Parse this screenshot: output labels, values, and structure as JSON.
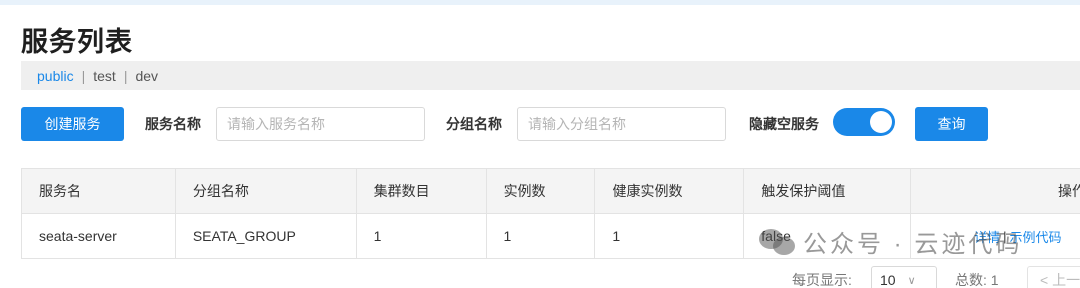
{
  "header": {
    "title": "服务列表"
  },
  "namespaces": {
    "items": [
      {
        "label": "public",
        "active": true
      },
      {
        "label": "test",
        "active": false
      },
      {
        "label": "dev",
        "active": false
      }
    ],
    "separator": "|"
  },
  "toolbar": {
    "create_label": "创建服务",
    "service_name_label": "服务名称",
    "service_name_placeholder": "请输入服务名称",
    "group_name_label": "分组名称",
    "group_name_placeholder": "请输入分组名称",
    "hide_empty_label": "隐藏空服务",
    "hide_empty_on": true,
    "query_label": "查询"
  },
  "table": {
    "columns": [
      "服务名",
      "分组名称",
      "集群数目",
      "实例数",
      "健康实例数",
      "触发保护阈值",
      "操作"
    ],
    "rows": [
      {
        "service": "seata-server",
        "group": "SEATA_GROUP",
        "clusters": "1",
        "instances": "1",
        "healthy": "1",
        "threshold": "false",
        "actions": [
          "详情",
          "示例代码"
        ],
        "action_sep": "|"
      }
    ]
  },
  "pagination": {
    "per_page_label": "每页显示:",
    "per_page_value": "10",
    "total_label": "总数: 1",
    "prev_label": "< 上一"
  },
  "watermark": {
    "text": "公众号 · 云迹代码"
  },
  "colors": {
    "accent": "#1a88e8",
    "header_bg": "#f4f4f4",
    "ns_bar_bg": "#efefef"
  }
}
